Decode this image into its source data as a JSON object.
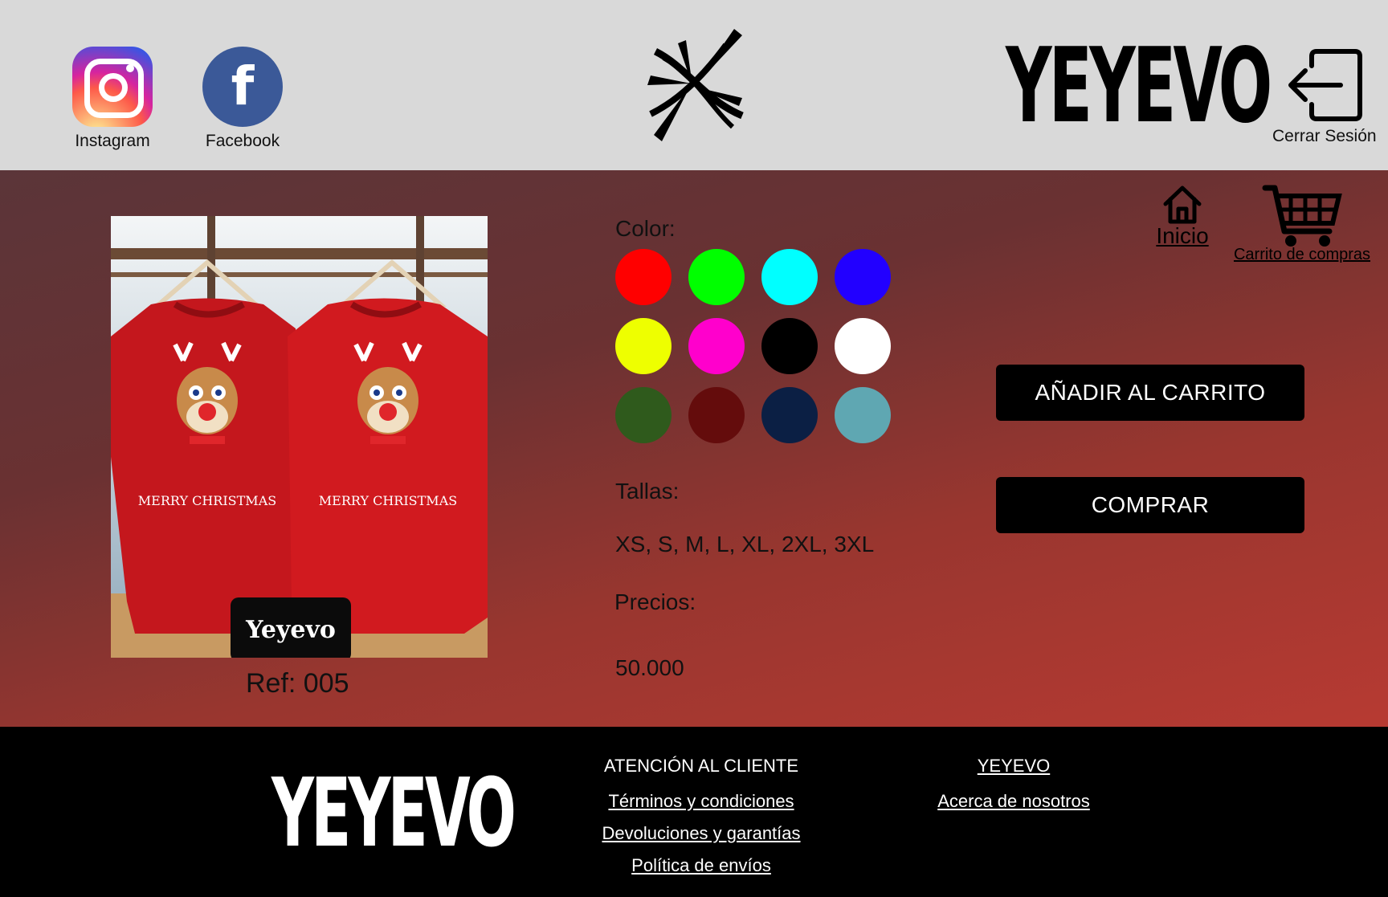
{
  "header": {
    "social": [
      {
        "label": "Instagram",
        "icon": "instagram-icon"
      },
      {
        "label": "Facebook",
        "icon": "facebook-icon",
        "glyph": "f"
      }
    ],
    "brand": "YEYEVO",
    "logout_label": "Cerrar Sesión"
  },
  "nav": {
    "home_label": "Inicio",
    "cart_label": "Carrito de compras"
  },
  "product": {
    "watermark": "Yeyevo",
    "ref": "Ref: 005",
    "color_label": "Color:",
    "colors": [
      "#ff0000",
      "#00ff00",
      "#00ffff",
      "#2200ff",
      "#eeff00",
      "#ff00cc",
      "#000000",
      "#ffffff",
      "#2f5a1c",
      "#640c0c",
      "#0b1f44",
      "#5fa7b2"
    ],
    "sizes_label": "Tallas:",
    "sizes": "XS, S, M, L, XL, 2XL, 3XL",
    "price_label": "Precios:",
    "price": "50.000",
    "print_text": "MERRY CHRISTMAS"
  },
  "actions": {
    "add_to_cart": "AÑADIR AL CARRITO",
    "buy": "COMPRAR"
  },
  "footer": {
    "brand": "YEYEVO",
    "customer_service": {
      "title": "ATENCIÓN AL CLIENTE",
      "links": [
        "Términos y condiciones",
        "Devoluciones y garantías",
        "Política de envíos"
      ]
    },
    "company": {
      "title": "YEYEVO",
      "links": [
        "Acerca de nosotros"
      ]
    }
  }
}
